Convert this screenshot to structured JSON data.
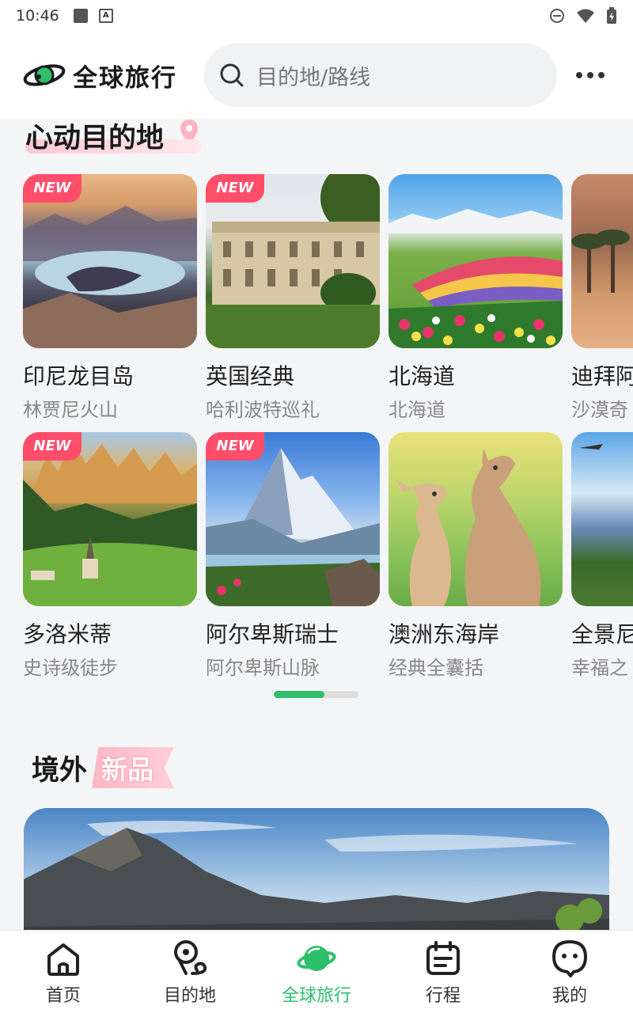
{
  "status_bar": {
    "time": "10:46"
  },
  "header": {
    "app_title": "全球旅行",
    "search_placeholder": "目的地/路线"
  },
  "section_hot": {
    "title": "心动目的地"
  },
  "destinations": [
    {
      "name": "印尼龙目岛",
      "sub": "林贾尼火山",
      "is_new": true,
      "new_label": "NEW"
    },
    {
      "name": "英国经典",
      "sub": "哈利波特巡礼",
      "is_new": true,
      "new_label": "NEW"
    },
    {
      "name": "北海道",
      "sub": "北海道",
      "is_new": false
    },
    {
      "name": "迪拜阿",
      "sub": "沙漠奇",
      "is_new": false
    },
    {
      "name": "多洛米蒂",
      "sub": "史诗级徒步",
      "is_new": true,
      "new_label": "NEW"
    },
    {
      "name": "阿尔卑斯瑞士",
      "sub": "阿尔卑斯山脉",
      "is_new": true,
      "new_label": "NEW"
    },
    {
      "name": "澳洲东海岸",
      "sub": "经典全囊括",
      "is_new": false
    },
    {
      "name": "全景尼",
      "sub": "幸福之",
      "is_new": false
    }
  ],
  "carousel_progress": 0.6,
  "section_new": {
    "title": "境外",
    "badge": "新品"
  },
  "tabbar": {
    "items": [
      {
        "label": "首页",
        "icon": "home-icon"
      },
      {
        "label": "目的地",
        "icon": "location-route-icon"
      },
      {
        "label": "全球旅行",
        "icon": "planet-icon",
        "active": true
      },
      {
        "label": "行程",
        "icon": "calendar-icon"
      },
      {
        "label": "我的",
        "icon": "user-face-icon"
      }
    ]
  },
  "colors": {
    "accent": "#2dbf6b",
    "new_badge": "#ff4d6a"
  }
}
